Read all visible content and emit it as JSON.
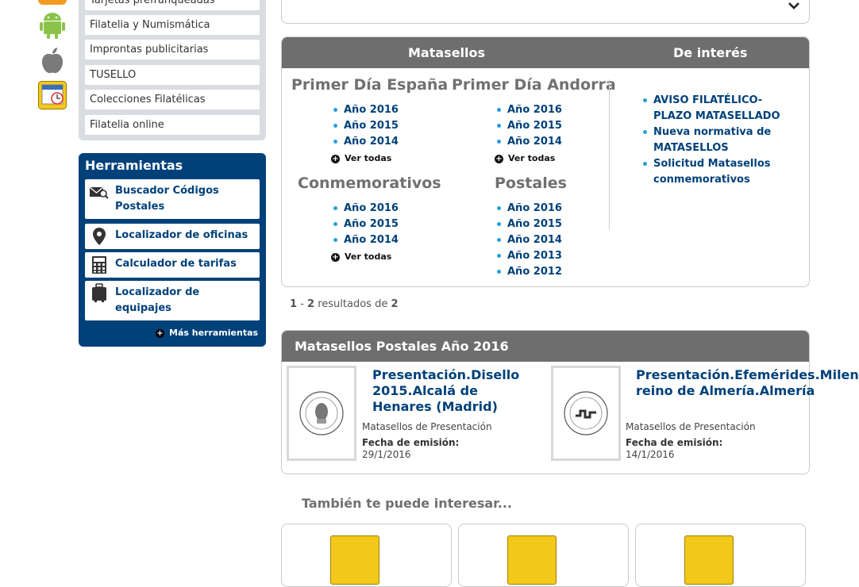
{
  "sidebar": {
    "items": [
      {
        "label": "Tarjetas prefranqueadas"
      },
      {
        "label": "Filatelia y Numismática"
      },
      {
        "label": "Improntas publicitarias"
      },
      {
        "label": "TUSELLO"
      },
      {
        "label": "Colecciones Filatélicas"
      },
      {
        "label": "Filatelia online"
      }
    ],
    "app_icons": [
      "rss-icon",
      "android-icon",
      "apple-icon",
      "calendar-icon"
    ]
  },
  "tools": {
    "title": "Herramientas",
    "items": [
      {
        "label": "Buscador Códigos Postales",
        "icon": "postal-search-icon"
      },
      {
        "label": "Localizador de oficinas",
        "icon": "map-pin-icon"
      },
      {
        "label": "Calculador de tarifas",
        "icon": "calculator-icon"
      },
      {
        "label": "Localizador de equipajes",
        "icon": "luggage-icon"
      }
    ],
    "more_label": "Más herramientas"
  },
  "matasellos": {
    "header_left": "Matasellos",
    "header_right": "De interés",
    "groups": [
      {
        "title": "Primer Día España",
        "years": [
          "Año 2016",
          "Año 2015",
          "Año 2014"
        ],
        "see_all": "Ver todas"
      },
      {
        "title": "Primer Día Andorra",
        "years": [
          "Año 2016",
          "Año 2015",
          "Año 2014"
        ],
        "see_all": "Ver todas"
      },
      {
        "title": "Conmemorativos",
        "years": [
          "Año 2016",
          "Año 2015",
          "Año 2014"
        ],
        "see_all": "Ver todas"
      },
      {
        "title": "Postales",
        "years": [
          "Año 2016",
          "Año 2015",
          "Año 2014",
          "Año 2013",
          "Año 2012"
        ]
      }
    ],
    "interest_links": [
      "AVISO FILATÉLICO-PLAZO MATASELLADO",
      "Nueva normativa de MATASELLOS",
      "Solicitud Matasellos conmemorativos"
    ]
  },
  "results": {
    "from": "1",
    "sep": "-",
    "to": "2",
    "text": "resultados de",
    "total": "2"
  },
  "postales": {
    "title": "Matasellos Postales Año 2016",
    "items": [
      {
        "title": "Presentación.Disello 2015.Alcalá de Henares (Madrid)",
        "type": "Matasellos de Presentación",
        "date_label": "Fecha de emisión:",
        "date": "29/1/2016"
      },
      {
        "title": "Presentación.Efemérides.Milenio reino de Almería.Almería",
        "type": "Matasellos de Presentación",
        "date_label": "Fecha de emisión:",
        "date": "14/1/2016"
      }
    ]
  },
  "tambien": {
    "title": "También te puede interesar..."
  },
  "colors": {
    "navy": "#00417a",
    "header_gray": "#6e6e6e",
    "bullet": "#2a9fd6"
  }
}
